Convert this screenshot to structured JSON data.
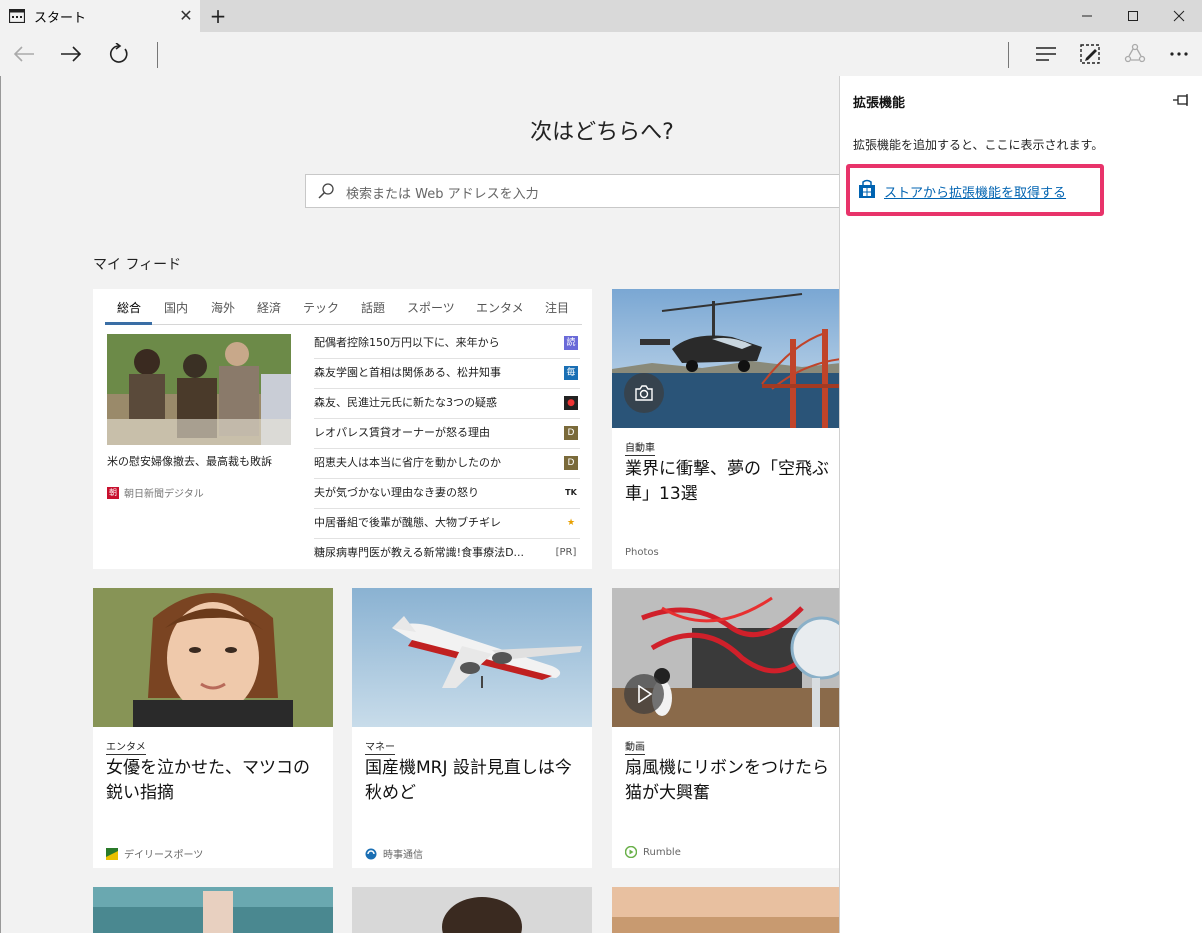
{
  "tab": {
    "title": "スタート"
  },
  "page": {
    "headline": "次はどちらへ?",
    "search_placeholder": "検索または Web アドレスを入力",
    "feed_title": "マイ フィード"
  },
  "news": {
    "categories": [
      "総合",
      "国内",
      "海外",
      "経済",
      "テック",
      "話題",
      "スポーツ",
      "エンタメ",
      "注目"
    ],
    "featured": {
      "caption": "米の慰安婦像撤去、最高裁も敗訴",
      "source": "朝日新聞デジタル",
      "source_logo": "朝"
    },
    "headlines": [
      {
        "text": "配偶者控除150万円以下に、来年から",
        "badge": "読",
        "color": "#6a6ad8"
      },
      {
        "text": "森友学園と首相は関係ある、松井知事",
        "badge": "毎",
        "color": "#1a6fb4"
      },
      {
        "text": "森友、民進辻元氏に新たな3つの疑惑",
        "badge": "●",
        "color": "#222222"
      },
      {
        "text": "レオパレス賃貸オーナーが怒る理由",
        "badge": "D",
        "color": "#7a6a3a"
      },
      {
        "text": "昭恵夫人は本当に省庁を動かしたのか",
        "badge": "D",
        "color": "#7a6a3a"
      },
      {
        "text": "夫が気づかない理由なき妻の怒り",
        "badge": "TK",
        "color": "#222222"
      },
      {
        "text": "中居番組で後輩が醜態、大物ブチギレ",
        "badge": "★",
        "color": "#e8a000"
      },
      {
        "text": "糖尿病専門医が教える新常識!食事療法D...",
        "badge": "[PR]",
        "color": "#ffffff"
      }
    ]
  },
  "stories": [
    {
      "category": "自動車",
      "title": "業界に衝撃、夢の「空飛ぶ車」13選",
      "source": "Photos"
    },
    {
      "category": "エンタメ",
      "title": "女優を泣かせた、マツコの鋭い指摘",
      "source": "デイリースポーツ"
    },
    {
      "category": "マネー",
      "title": "国産機MRJ 設計見直しは今秋めど",
      "source": "時事通信"
    },
    {
      "category": "動画",
      "title": "扇風機にリボンをつけたら猫が大興奮",
      "source": "Rumble"
    }
  ],
  "extensions": {
    "title": "拡張機能",
    "message": "拡張機能を追加すると、ここに表示されます。",
    "store_link": "ストアから拡張機能を取得する"
  },
  "colors": {
    "accent": "#0063b1",
    "highlight": "#e8336a",
    "tab_underline": "#3a6ea5"
  },
  "icons": [
    "tab-page-icon",
    "close-icon",
    "plus-icon",
    "minimize-icon",
    "maximize-icon",
    "back-icon",
    "forward-icon",
    "refresh-icon",
    "hub-icon",
    "note-icon",
    "share-icon",
    "more-icon",
    "search-icon",
    "pin-icon",
    "store-icon",
    "camera-icon",
    "play-icon"
  ]
}
